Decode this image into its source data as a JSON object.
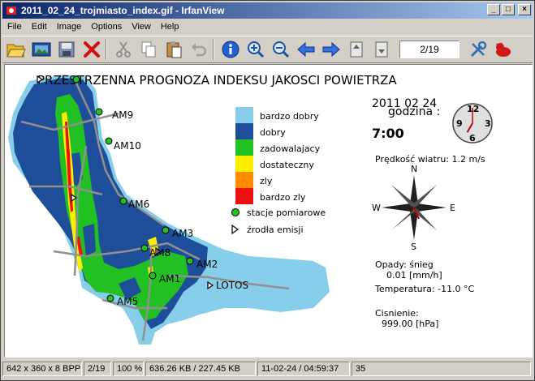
{
  "window": {
    "title": "2011_02_24_trojmiasto_index.gif - IrfanView"
  },
  "menu": [
    "File",
    "Edit",
    "Image",
    "Options",
    "View",
    "Help"
  ],
  "toolbar": {
    "page_indicator": "2/19"
  },
  "image": {
    "heading": "PRZESTRZENNA PROGNOZA INDEKSU JAKOSCI POWIETRZA",
    "date": "2011 02 24",
    "hour_label": "godzina :",
    "hour": "7:00",
    "clock": {
      "numerals": [
        "12",
        "3",
        "6",
        "9"
      ],
      "hour": 7,
      "minute": 0
    },
    "wind": "Prędkość wiatru: 1.2 m/s",
    "compass": {
      "n": "N",
      "e": "E",
      "s": "S",
      "w": "W"
    },
    "precip_label": "Opady: śnieg",
    "precip_value": "0.01 [mm/h]",
    "temperature": "Temperatura: -11.0 °C",
    "pressure_label": "Cisnienie:",
    "pressure_value": "999.00 [hPa]",
    "legend": [
      {
        "label": "bardzo dobry",
        "color": "#87ceeb"
      },
      {
        "label": "dobry",
        "color": "#1e4d9a"
      },
      {
        "label": "zadowalajacy",
        "color": "#22c022"
      },
      {
        "label": "dostateczny",
        "color": "#ffee00"
      },
      {
        "label": "zly",
        "color": "#ff8c00"
      },
      {
        "label": "bardzo zly",
        "color": "#ee1111"
      }
    ],
    "legend_stations": "stacje pomiarowe",
    "legend_emission": "źrodła emisji",
    "station_labels": [
      "AM9",
      "AM10",
      "AM6",
      "AM3",
      "AM8",
      "AM2",
      "AM1",
      "AM5",
      "LOTOS"
    ]
  },
  "status": {
    "dimensions": "642 x 360 x 8 BPP",
    "page": "2/19",
    "zoom": "100 %",
    "size": "636.26 KB / 227.45 KB",
    "datetime": "11-02-24 / 04:59:37",
    "extra": "35"
  }
}
